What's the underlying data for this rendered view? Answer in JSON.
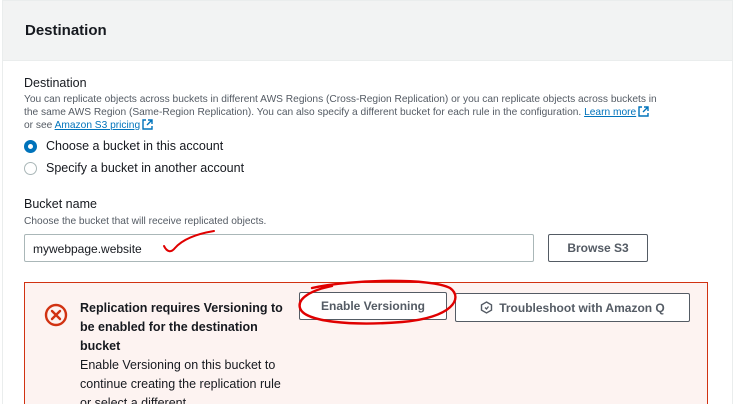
{
  "panel": {
    "title": "Destination"
  },
  "destination": {
    "label": "Destination",
    "description_line1": "You can replicate objects across buckets in different AWS Regions (Cross-Region Replication) or you can replicate objects across buckets in",
    "description_line2": "the same AWS Region (Same-Region Replication). You can also specify a different bucket for each rule in the configuration.",
    "learn_more": "Learn more",
    "see_prefix": "or see",
    "pricing_link": "Amazon S3 pricing",
    "options": [
      {
        "label": "Choose a bucket in this account",
        "selected": true
      },
      {
        "label": "Specify a bucket in another account",
        "selected": false
      }
    ]
  },
  "bucket": {
    "label": "Bucket name",
    "description": "Choose the bucket that will receive replicated objects.",
    "value": "mywebpage.website",
    "browse_label": "Browse S3"
  },
  "alert": {
    "title": "Replication requires Versioning to be enabled for the destination bucket",
    "body": "Enable Versioning on this bucket to continue creating the replication rule or select a different",
    "enable_versioning_label": "Enable Versioning",
    "troubleshoot_label": "Troubleshoot with Amazon Q",
    "icon": "error-x-icon"
  },
  "colors": {
    "link": "#0073bb",
    "error": "#d13212",
    "alert_bg": "#fdf3f1",
    "annotation": "#e00000"
  }
}
